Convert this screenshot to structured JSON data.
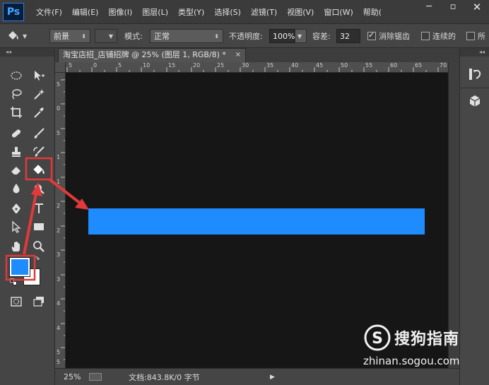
{
  "app": {
    "logo_text": "Ps"
  },
  "menu": [
    "文件(F)",
    "编辑(E)",
    "图像(I)",
    "图层(L)",
    "类型(Y)",
    "选择(S)",
    "滤镜(T)",
    "视图(V)",
    "窗口(W)",
    "帮助("
  ],
  "window_controls": {
    "minimize": "─",
    "restore": "▫",
    "close": "✕"
  },
  "options": {
    "fill_source": "前景",
    "mode_label": "模式:",
    "mode_value": "正常",
    "opacity_label": "不透明度:",
    "opacity_value": "100%",
    "tolerance_label": "容差:",
    "tolerance_value": "32",
    "antialias_label": "消除锯齿",
    "antialias_checked": true,
    "contiguous_label": "连续的",
    "contiguous_checked": false,
    "all_layers_label": "所"
  },
  "document": {
    "tab_title": "淘宝店招_店铺招牌 @ 25% (图层 1, RGB/8) *",
    "close_glyph": "×",
    "shape_color": "#1e8cff",
    "background_color": "#161616"
  },
  "rulers": {
    "h_labels": [
      "5",
      "0",
      "5",
      "10",
      "15",
      "20",
      "25",
      "30",
      "35",
      "40",
      "45",
      "50",
      "55",
      "60",
      "65",
      "70"
    ],
    "v_labels": [
      "5",
      "0",
      "5",
      "1",
      "1",
      "2",
      "2",
      "3",
      "3",
      "4",
      "4",
      "5",
      "5"
    ]
  },
  "colors": {
    "foreground": "#1e8cff",
    "background": "#ffffff",
    "highlight": "#e03a3a"
  },
  "status": {
    "zoom": "25%",
    "doc_info": "文档:843.8K/0 字节",
    "more_glyph": "▶"
  },
  "right_panel": {
    "collapse_glyph": "◂◂"
  },
  "toolbar": {
    "collapse_glyph": "◂◂"
  },
  "watermark": {
    "brand": "搜狗指南",
    "url": "zhinan.sogou.com",
    "logo_letter": "S"
  }
}
